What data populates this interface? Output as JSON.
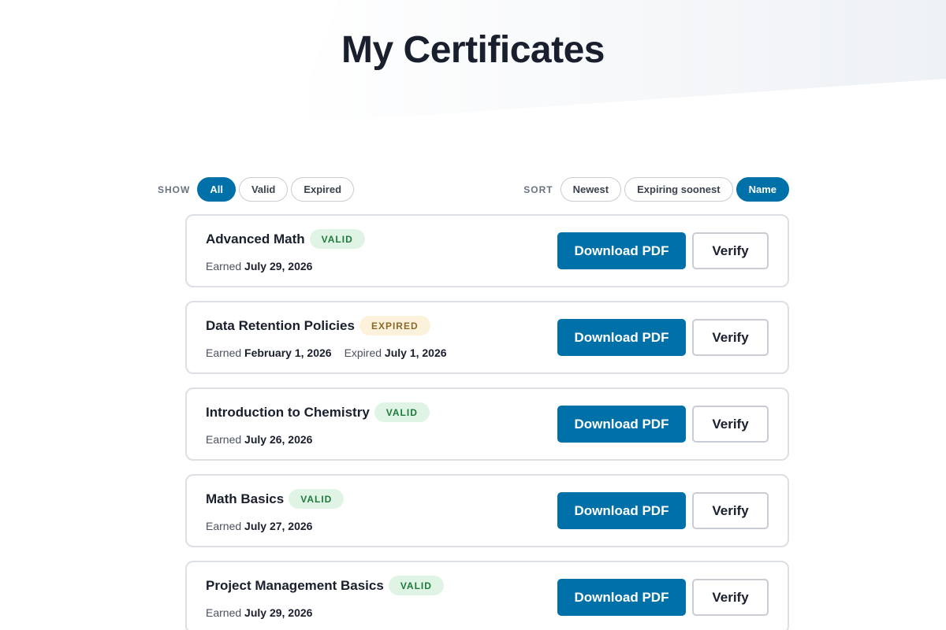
{
  "page": {
    "title": "My Certificates"
  },
  "filters": {
    "show_label": "SHOW",
    "show_options": [
      {
        "label": "All",
        "active": true
      },
      {
        "label": "Valid",
        "active": false
      },
      {
        "label": "Expired",
        "active": false
      }
    ],
    "sort_label": "SORT",
    "sort_options": [
      {
        "label": "Newest",
        "active": false
      },
      {
        "label": "Expiring soonest",
        "active": false
      },
      {
        "label": "Name",
        "active": true
      }
    ]
  },
  "certificates": [
    {
      "title": "Advanced Math",
      "status": "VALID",
      "status_type": "valid",
      "earned_label": "Earned",
      "earned_date": "July 29, 2026"
    },
    {
      "title": "Data Retention Policies",
      "status": "EXPIRED",
      "status_type": "expired",
      "earned_label": "Earned",
      "earned_date": "February 1, 2026",
      "expired_label": "Expired",
      "expired_date": "July 1, 2026"
    },
    {
      "title": "Introduction to Chemistry",
      "status": "VALID",
      "status_type": "valid",
      "earned_label": "Earned",
      "earned_date": "July 26, 2026"
    },
    {
      "title": "Math Basics",
      "status": "VALID",
      "status_type": "valid",
      "earned_label": "Earned",
      "earned_date": "July 27, 2026"
    },
    {
      "title": "Project Management Basics",
      "status": "VALID",
      "status_type": "valid",
      "earned_label": "Earned",
      "earned_date": "July 29, 2026"
    }
  ],
  "actions": {
    "download_label": "Download PDF",
    "verify_label": "Verify"
  },
  "colors": {
    "primary": "#0070a8",
    "valid_bg": "#dff4e4",
    "valid_text": "#1e7a3a",
    "expired_bg": "#fcf2dc",
    "expired_text": "#8a6a2a",
    "heading": "#1a1f2e"
  }
}
